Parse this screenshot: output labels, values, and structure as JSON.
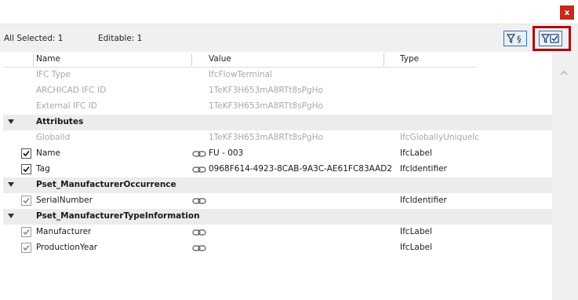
{
  "window": {
    "close_label": "x"
  },
  "toolbar": {
    "all_selected": "All Selected: 1",
    "editable": "Editable: 1"
  },
  "columns": {
    "name": "Name",
    "value": "Value",
    "type": "Type"
  },
  "rows": [
    {
      "name": "IFC Type",
      "value": "IfcFlowTerminal",
      "type": ""
    },
    {
      "name": "ARCHICAD IFC ID",
      "value": "1TeKF3H653mA8RTt8sPgHo",
      "type": ""
    },
    {
      "name": "External IFC ID",
      "value": "1TeKF3H653mA8RTt8sPgHo",
      "type": ""
    },
    {
      "group": "Attributes"
    },
    {
      "name": "GlobalId",
      "value": "1TeKF3H653mA8RTt8sPgHo",
      "type": "IfcGloballyUniqueId"
    },
    {
      "name": "Name",
      "value": "FU - 003",
      "type": "IfcLabel"
    },
    {
      "name": "Tag",
      "value": "0968F614-4923-8CAB-9A3C-AE61FC83AAD2",
      "type": "IfcIdentifier"
    },
    {
      "group": "Pset_ManufacturerOccurrence"
    },
    {
      "name": "SerialNumber",
      "value": "",
      "type": "IfcIdentifier"
    },
    {
      "group": "Pset_ManufacturerTypeInformation"
    },
    {
      "name": "Manufacturer",
      "value": "",
      "type": "IfcLabel"
    },
    {
      "name": "ProductionYear",
      "value": "",
      "type": "IfcLabel"
    }
  ]
}
